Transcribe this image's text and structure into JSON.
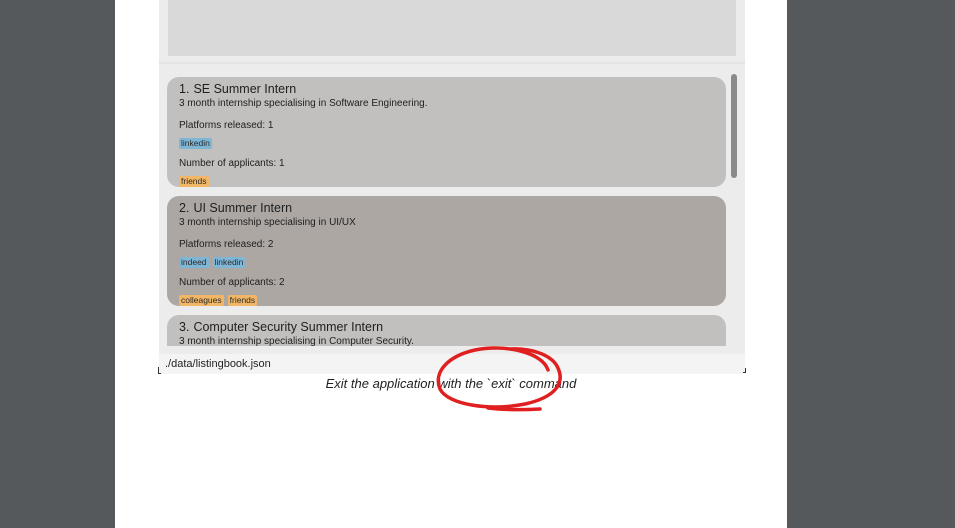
{
  "listings": [
    {
      "index": "1.",
      "title": "SE Summer Intern",
      "description": "3 month internship specialising in Software Engineering.",
      "platforms_label": "Platforms released: 1",
      "platforms": [
        "linkedin"
      ],
      "applicants_label": "Number of applicants: 1",
      "applicants": [
        "friends"
      ]
    },
    {
      "index": "2.",
      "title": "UI Summer Intern",
      "description": "3 month internship specialising in UI/UX",
      "platforms_label": "Platforms released: 2",
      "platforms": [
        "indeed",
        "linkedin"
      ],
      "applicants_label": "Number of applicants: 2",
      "applicants": [
        "colleagues",
        "friends"
      ]
    },
    {
      "index": "3.",
      "title": "Computer Security Summer Intern",
      "description": "3 month internship specialising in Computer Security."
    }
  ],
  "status_bar": {
    "path": "./data/listingbook.json"
  },
  "caption": "Exit the application with the `exit` command",
  "colors": {
    "tag_platform": "#7fb6d6",
    "tag_applicant": "#f2b766",
    "annotation": "#e02020"
  }
}
